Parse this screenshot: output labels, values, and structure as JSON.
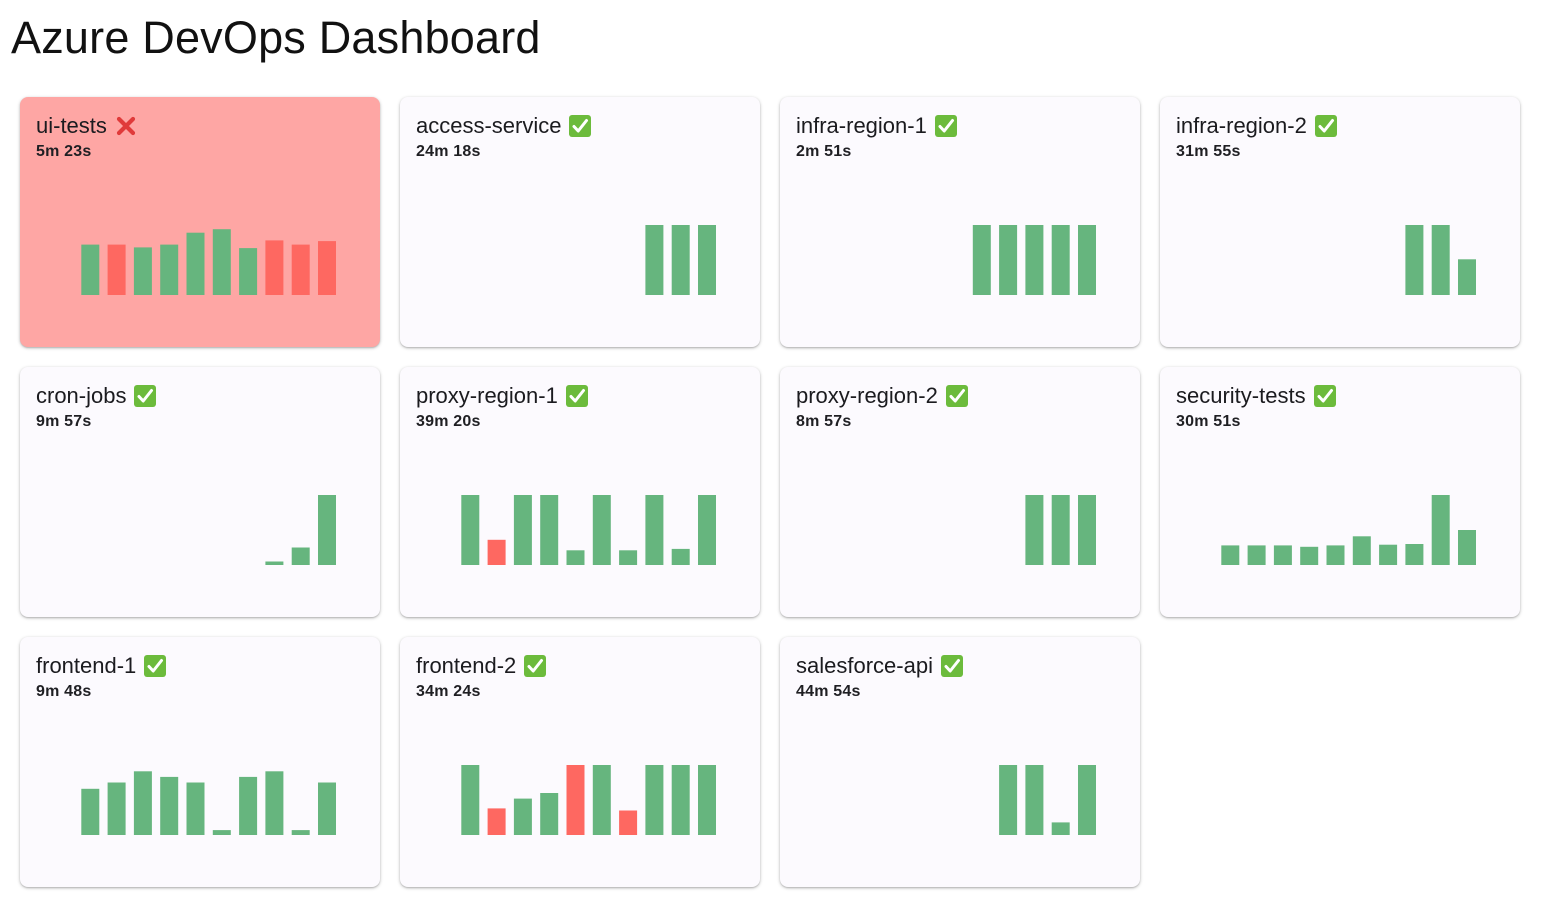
{
  "page": {
    "title": "Azure DevOps Dashboard"
  },
  "colors": {
    "success": "#66b57e",
    "failure": "#fe6861",
    "card_failed_bg": "#fea6a4",
    "card_bg": "#fcfafe",
    "check_icon": "#6cbb3c",
    "cross_icon": "#e03a3a"
  },
  "pipelines": [
    {
      "name": "ui-tests",
      "status": "failed",
      "status_icon": "cross-mark-icon",
      "duration": "5m 23s",
      "history": [
        {
          "value": 0.72,
          "result": "success"
        },
        {
          "value": 0.72,
          "result": "failure"
        },
        {
          "value": 0.68,
          "result": "success"
        },
        {
          "value": 0.72,
          "result": "success"
        },
        {
          "value": 0.89,
          "result": "success"
        },
        {
          "value": 0.94,
          "result": "success"
        },
        {
          "value": 0.67,
          "result": "success"
        },
        {
          "value": 0.78,
          "result": "failure"
        },
        {
          "value": 0.72,
          "result": "failure"
        },
        {
          "value": 0.77,
          "result": "failure"
        }
      ]
    },
    {
      "name": "access-service",
      "status": "succeeded",
      "status_icon": "check-mark-icon",
      "duration": "24m 18s",
      "history": [
        {
          "value": 1.0,
          "result": "success"
        },
        {
          "value": 1.0,
          "result": "success"
        },
        {
          "value": 1.0,
          "result": "success"
        }
      ]
    },
    {
      "name": "infra-region-1",
      "status": "succeeded",
      "status_icon": "check-mark-icon",
      "duration": "2m 51s",
      "history": [
        {
          "value": 1.0,
          "result": "success"
        },
        {
          "value": 1.0,
          "result": "success"
        },
        {
          "value": 1.0,
          "result": "success"
        },
        {
          "value": 1.0,
          "result": "success"
        },
        {
          "value": 1.0,
          "result": "success"
        }
      ]
    },
    {
      "name": "infra-region-2",
      "status": "succeeded",
      "status_icon": "check-mark-icon",
      "duration": "31m 55s",
      "history": [
        {
          "value": 1.0,
          "result": "success"
        },
        {
          "value": 1.0,
          "result": "success"
        },
        {
          "value": 0.51,
          "result": "success"
        }
      ]
    },
    {
      "name": "cron-jobs",
      "status": "succeeded",
      "status_icon": "check-mark-icon",
      "duration": "9m 57s",
      "history": [
        {
          "value": 0.05,
          "result": "success"
        },
        {
          "value": 0.25,
          "result": "success"
        },
        {
          "value": 1.0,
          "result": "success"
        }
      ]
    },
    {
      "name": "proxy-region-1",
      "status": "succeeded",
      "status_icon": "check-mark-icon",
      "duration": "39m 20s",
      "history": [
        {
          "value": 1.0,
          "result": "success"
        },
        {
          "value": 0.36,
          "result": "failure"
        },
        {
          "value": 1.0,
          "result": "success"
        },
        {
          "value": 1.0,
          "result": "success"
        },
        {
          "value": 0.21,
          "result": "success"
        },
        {
          "value": 1.0,
          "result": "success"
        },
        {
          "value": 0.21,
          "result": "success"
        },
        {
          "value": 1.0,
          "result": "success"
        },
        {
          "value": 0.23,
          "result": "success"
        },
        {
          "value": 1.0,
          "result": "success"
        }
      ]
    },
    {
      "name": "proxy-region-2",
      "status": "succeeded",
      "status_icon": "check-mark-icon",
      "duration": "8m 57s",
      "history": [
        {
          "value": 1.0,
          "result": "success"
        },
        {
          "value": 1.0,
          "result": "success"
        },
        {
          "value": 1.0,
          "result": "success"
        }
      ]
    },
    {
      "name": "security-tests",
      "status": "succeeded",
      "status_icon": "check-mark-icon",
      "duration": "30m 51s",
      "history": [
        {
          "value": 0.28,
          "result": "success"
        },
        {
          "value": 0.28,
          "result": "success"
        },
        {
          "value": 0.28,
          "result": "success"
        },
        {
          "value": 0.26,
          "result": "success"
        },
        {
          "value": 0.28,
          "result": "success"
        },
        {
          "value": 0.41,
          "result": "success"
        },
        {
          "value": 0.29,
          "result": "success"
        },
        {
          "value": 0.3,
          "result": "success"
        },
        {
          "value": 1.0,
          "result": "success"
        },
        {
          "value": 0.5,
          "result": "success"
        }
      ]
    },
    {
      "name": "frontend-1",
      "status": "succeeded",
      "status_icon": "check-mark-icon",
      "duration": "9m 48s",
      "history": [
        {
          "value": 0.66,
          "result": "success"
        },
        {
          "value": 0.75,
          "result": "success"
        },
        {
          "value": 0.91,
          "result": "success"
        },
        {
          "value": 0.83,
          "result": "success"
        },
        {
          "value": 0.75,
          "result": "success"
        },
        {
          "value": 0.07,
          "result": "success"
        },
        {
          "value": 0.83,
          "result": "success"
        },
        {
          "value": 0.91,
          "result": "success"
        },
        {
          "value": 0.07,
          "result": "success"
        },
        {
          "value": 0.75,
          "result": "success"
        }
      ]
    },
    {
      "name": "frontend-2",
      "status": "succeeded",
      "status_icon": "check-mark-icon",
      "duration": "34m 24s",
      "history": [
        {
          "value": 1.0,
          "result": "success"
        },
        {
          "value": 0.38,
          "result": "failure"
        },
        {
          "value": 0.52,
          "result": "success"
        },
        {
          "value": 0.6,
          "result": "success"
        },
        {
          "value": 1.0,
          "result": "failure"
        },
        {
          "value": 1.0,
          "result": "success"
        },
        {
          "value": 0.35,
          "result": "failure"
        },
        {
          "value": 1.0,
          "result": "success"
        },
        {
          "value": 1.0,
          "result": "success"
        },
        {
          "value": 1.0,
          "result": "success"
        }
      ]
    },
    {
      "name": "salesforce-api",
      "status": "succeeded",
      "status_icon": "check-mark-icon",
      "duration": "44m 54s",
      "history": [
        {
          "value": 1.0,
          "result": "success"
        },
        {
          "value": 1.0,
          "result": "success"
        },
        {
          "value": 0.18,
          "result": "success"
        },
        {
          "value": 1.0,
          "result": "success"
        }
      ]
    }
  ]
}
